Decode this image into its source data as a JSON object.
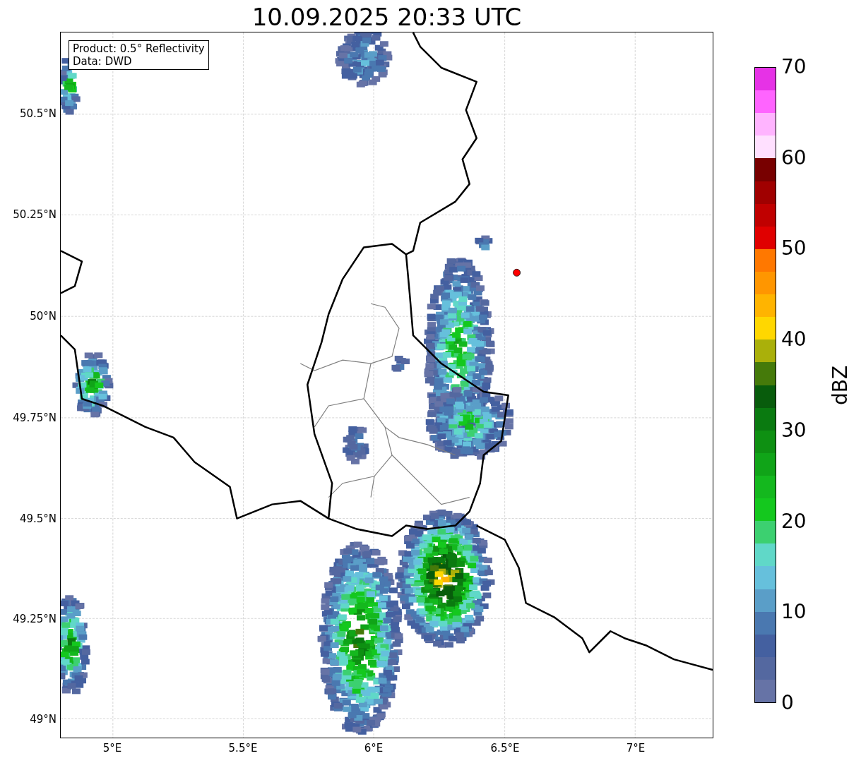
{
  "title": "10.09.2025 20:33 UTC",
  "info_box": [
    "Product: 0.5° Reflectivity",
    "Data: DWD"
  ],
  "x_ticks": [
    "5°E",
    "5.5°E",
    "6°E",
    "6.5°E",
    "7°E"
  ],
  "y_ticks": [
    "50.5°N",
    "50.25°N",
    "50°N",
    "49.75°N",
    "49.5°N",
    "49.25°N",
    "49°N"
  ],
  "colorbar": {
    "label": "dBZ",
    "ticks": [
      "70",
      "60",
      "50",
      "40",
      "30",
      "20",
      "10",
      "0"
    ],
    "bands": [
      {
        "color": "#e632e6"
      },
      {
        "color": "#ff64ff"
      },
      {
        "color": "#ffb4ff"
      },
      {
        "color": "#ffe0ff"
      },
      {
        "color": "#780000"
      },
      {
        "color": "#a00000"
      },
      {
        "color": "#c00000"
      },
      {
        "color": "#e00000"
      },
      {
        "color": "#ff7800"
      },
      {
        "color": "#ff9600"
      },
      {
        "color": "#ffb400"
      },
      {
        "color": "#ffd700"
      },
      {
        "color": "#aab00a"
      },
      {
        "color": "#457a0a"
      },
      {
        "color": "#085c0c"
      },
      {
        "color": "#0a7a10"
      },
      {
        "color": "#0e9012"
      },
      {
        "color": "#10a418"
      },
      {
        "color": "#14b81e"
      },
      {
        "color": "#14c81e"
      },
      {
        "color": "#3cd070"
      },
      {
        "color": "#60d8c8"
      },
      {
        "color": "#66c0dc"
      },
      {
        "color": "#5a9ec8"
      },
      {
        "color": "#4a78b0"
      },
      {
        "color": "#4460a0"
      },
      {
        "color": "#5468a0"
      },
      {
        "color": "#6673a6"
      }
    ]
  }
}
